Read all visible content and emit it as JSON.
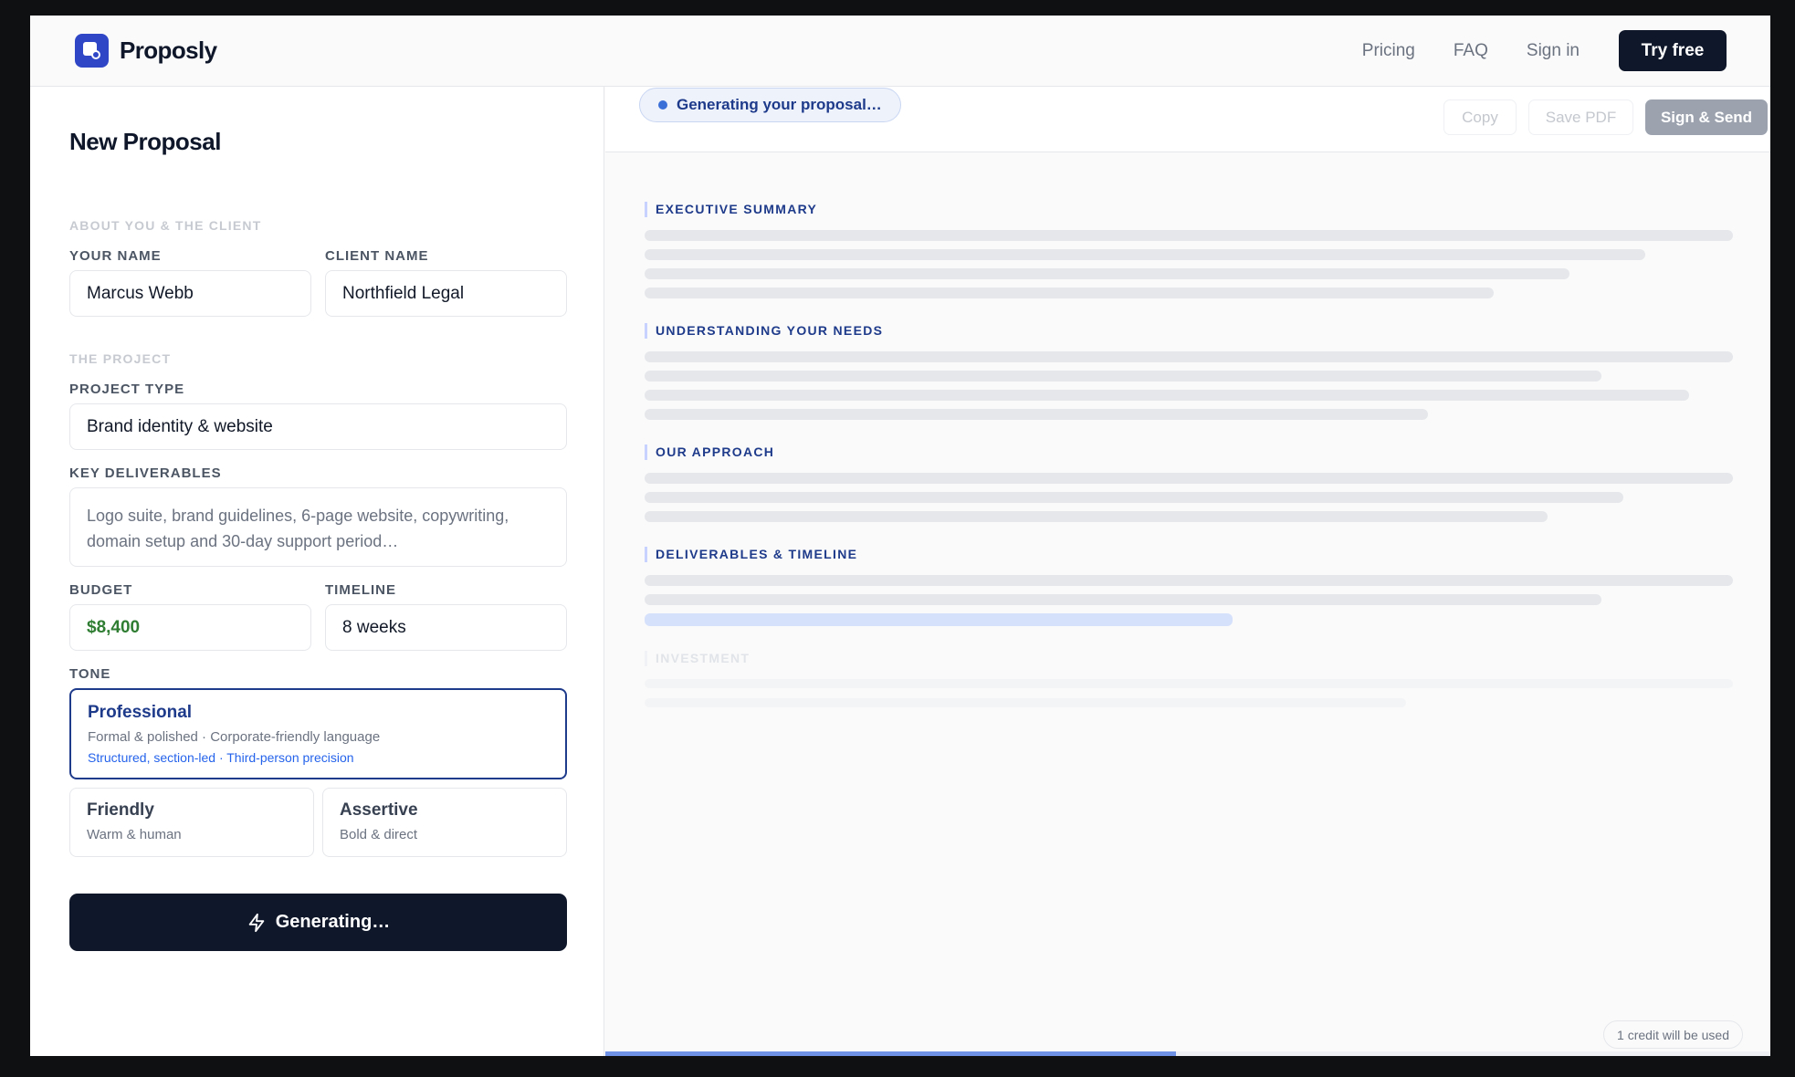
{
  "brand": {
    "name": "Proposly"
  },
  "nav": {
    "pricing": "Pricing",
    "faq": "FAQ",
    "sign_in": "Sign in",
    "try_free": "Try free"
  },
  "form": {
    "title": "New Proposal",
    "section_about": "ABOUT YOU & THE CLIENT",
    "your_name_label": "YOUR NAME",
    "your_name_value": "Marcus Webb",
    "client_name_label": "CLIENT NAME",
    "client_name_value": "Northfield Legal",
    "section_project": "THE PROJECT",
    "project_type_label": "PROJECT TYPE",
    "project_type_value": "Brand identity & website",
    "deliverables_label": "KEY DELIVERABLES",
    "deliverables_value": "Logo suite, brand guidelines, 6-page website, copywriting, domain setup and 30-day support period…",
    "budget_label": "BUDGET",
    "budget_value": "$8,400",
    "timeline_label": "TIMELINE",
    "timeline_value": "8 weeks",
    "tone_label": "TONE",
    "tones": [
      {
        "name": "Professional",
        "desc": "Formal & polished · Corporate-friendly language",
        "extra": "Structured, section-led · Third-person precision",
        "selected": true
      },
      {
        "name": "Friendly",
        "desc": "Warm & human",
        "selected": false
      },
      {
        "name": "Assertive",
        "desc": "Bold & direct",
        "selected": false
      }
    ],
    "generate_label": "Generating…"
  },
  "preview": {
    "status": "Generating your proposal…",
    "copy_label": "Copy",
    "save_pdf_label": "Save PDF",
    "sign_send_label": "Sign & Send",
    "sections": [
      {
        "heading": "EXECUTIVE SUMMARY"
      },
      {
        "heading": "UNDERSTANDING YOUR NEEDS"
      },
      {
        "heading": "OUR APPROACH"
      },
      {
        "heading": "DELIVERABLES & TIMELINE"
      },
      {
        "heading": "INVESTMENT"
      }
    ],
    "credit_note": "1 credit will be used",
    "progress": 0.49
  },
  "colors": {
    "brand": "#2f47c7",
    "dark": "#0f172a",
    "accent": "#1e3a8a",
    "budget_green": "#2e7d32"
  },
  "icons": {
    "generate": "lightning-bolt-icon",
    "status": "status-dot-icon",
    "logo": "proposly-logo-icon"
  }
}
